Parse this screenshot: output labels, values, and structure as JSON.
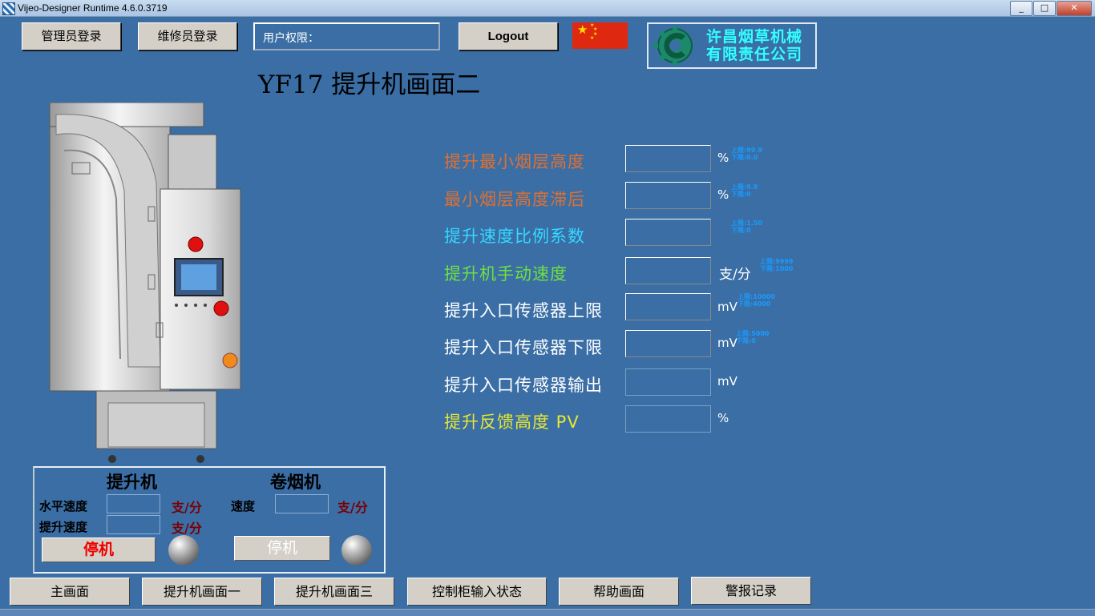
{
  "window": {
    "title": "Vijeo-Designer Runtime 4.6.0.3719",
    "min": "_",
    "max": "□",
    "close": "✕"
  },
  "header": {
    "admin_login": "管理员登录",
    "maint_login": "维修员登录",
    "permission_label": "用户权限：",
    "logout": "Logout",
    "flag_icon": "china-flag-icon",
    "company_line1": "许昌烟草机械",
    "company_line2": "有限责任公司",
    "logo_icon": "company-logo-icon"
  },
  "page_title": "YF17  提升机画面二",
  "params": [
    {
      "label": "提升最小烟层高度",
      "color": "#e07030",
      "unit": "%",
      "range_max": "上限:99.9",
      "range_min": "下限:0.0"
    },
    {
      "label": "最小烟层高度滞后",
      "color": "#e07030",
      "unit": "%",
      "range_max": "上限:9.9",
      "range_min": "下限:0"
    },
    {
      "label": "提升速度比例系数",
      "color": "#35d8ff",
      "unit": "",
      "range_max": "上限:1.50",
      "range_min": "下限:0"
    },
    {
      "label": "提升机手动速度",
      "color": "#6fe040",
      "unit": "支/分",
      "range_max": "上限:9999",
      "range_min": "下限:1000"
    },
    {
      "label": "提升入口传感器上限",
      "color": "#ffffff",
      "unit": "mV",
      "range_max": "上限:10000",
      "range_min": "下限:4000"
    },
    {
      "label": "提升入口传感器下限",
      "color": "#ffffff",
      "unit": "mV",
      "range_max": "上限:5000",
      "range_min": "下限:0"
    },
    {
      "label": "提升入口传感器输出",
      "color": "#ffffff",
      "unit": "mV",
      "range_max": "",
      "range_min": ""
    },
    {
      "label": "提升反馈高度 PV",
      "color": "#e8e830",
      "unit": "%",
      "range_max": "",
      "range_min": ""
    }
  ],
  "panel": {
    "elevator_title": "提升机",
    "cigarette_title": "卷烟机",
    "horizontal_speed": "水平速度",
    "lift_speed": "提升速度",
    "speed": "速度",
    "unit": "支/分",
    "elevator_stop": "停机",
    "cigarette_stop": "停机"
  },
  "nav": [
    "主画面",
    "提升机画面一",
    "提升机画面三",
    "控制柜输入状态",
    "帮助画面",
    "警报记录"
  ]
}
